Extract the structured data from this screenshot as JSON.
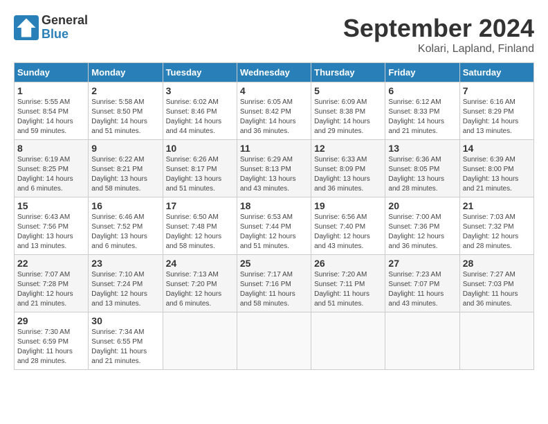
{
  "header": {
    "logo_line1": "General",
    "logo_line2": "Blue",
    "month": "September 2024",
    "location": "Kolari, Lapland, Finland"
  },
  "days_of_week": [
    "Sunday",
    "Monday",
    "Tuesday",
    "Wednesday",
    "Thursday",
    "Friday",
    "Saturday"
  ],
  "weeks": [
    [
      {
        "day": "1",
        "sunrise": "5:55 AM",
        "sunset": "8:54 PM",
        "daylight": "14 hours and 59 minutes."
      },
      {
        "day": "2",
        "sunrise": "5:58 AM",
        "sunset": "8:50 PM",
        "daylight": "14 hours and 51 minutes."
      },
      {
        "day": "3",
        "sunrise": "6:02 AM",
        "sunset": "8:46 PM",
        "daylight": "14 hours and 44 minutes."
      },
      {
        "day": "4",
        "sunrise": "6:05 AM",
        "sunset": "8:42 PM",
        "daylight": "14 hours and 36 minutes."
      },
      {
        "day": "5",
        "sunrise": "6:09 AM",
        "sunset": "8:38 PM",
        "daylight": "14 hours and 29 minutes."
      },
      {
        "day": "6",
        "sunrise": "6:12 AM",
        "sunset": "8:33 PM",
        "daylight": "14 hours and 21 minutes."
      },
      {
        "day": "7",
        "sunrise": "6:16 AM",
        "sunset": "8:29 PM",
        "daylight": "14 hours and 13 minutes."
      }
    ],
    [
      {
        "day": "8",
        "sunrise": "6:19 AM",
        "sunset": "8:25 PM",
        "daylight": "14 hours and 6 minutes."
      },
      {
        "day": "9",
        "sunrise": "6:22 AM",
        "sunset": "8:21 PM",
        "daylight": "13 hours and 58 minutes."
      },
      {
        "day": "10",
        "sunrise": "6:26 AM",
        "sunset": "8:17 PM",
        "daylight": "13 hours and 51 minutes."
      },
      {
        "day": "11",
        "sunrise": "6:29 AM",
        "sunset": "8:13 PM",
        "daylight": "13 hours and 43 minutes."
      },
      {
        "day": "12",
        "sunrise": "6:33 AM",
        "sunset": "8:09 PM",
        "daylight": "13 hours and 36 minutes."
      },
      {
        "day": "13",
        "sunrise": "6:36 AM",
        "sunset": "8:05 PM",
        "daylight": "13 hours and 28 minutes."
      },
      {
        "day": "14",
        "sunrise": "6:39 AM",
        "sunset": "8:00 PM",
        "daylight": "13 hours and 21 minutes."
      }
    ],
    [
      {
        "day": "15",
        "sunrise": "6:43 AM",
        "sunset": "7:56 PM",
        "daylight": "13 hours and 13 minutes."
      },
      {
        "day": "16",
        "sunrise": "6:46 AM",
        "sunset": "7:52 PM",
        "daylight": "13 hours and 6 minutes."
      },
      {
        "day": "17",
        "sunrise": "6:50 AM",
        "sunset": "7:48 PM",
        "daylight": "12 hours and 58 minutes."
      },
      {
        "day": "18",
        "sunrise": "6:53 AM",
        "sunset": "7:44 PM",
        "daylight": "12 hours and 51 minutes."
      },
      {
        "day": "19",
        "sunrise": "6:56 AM",
        "sunset": "7:40 PM",
        "daylight": "12 hours and 43 minutes."
      },
      {
        "day": "20",
        "sunrise": "7:00 AM",
        "sunset": "7:36 PM",
        "daylight": "12 hours and 36 minutes."
      },
      {
        "day": "21",
        "sunrise": "7:03 AM",
        "sunset": "7:32 PM",
        "daylight": "12 hours and 28 minutes."
      }
    ],
    [
      {
        "day": "22",
        "sunrise": "7:07 AM",
        "sunset": "7:28 PM",
        "daylight": "12 hours and 21 minutes."
      },
      {
        "day": "23",
        "sunrise": "7:10 AM",
        "sunset": "7:24 PM",
        "daylight": "12 hours and 13 minutes."
      },
      {
        "day": "24",
        "sunrise": "7:13 AM",
        "sunset": "7:20 PM",
        "daylight": "12 hours and 6 minutes."
      },
      {
        "day": "25",
        "sunrise": "7:17 AM",
        "sunset": "7:16 PM",
        "daylight": "11 hours and 58 minutes."
      },
      {
        "day": "26",
        "sunrise": "7:20 AM",
        "sunset": "7:11 PM",
        "daylight": "11 hours and 51 minutes."
      },
      {
        "day": "27",
        "sunrise": "7:23 AM",
        "sunset": "7:07 PM",
        "daylight": "11 hours and 43 minutes."
      },
      {
        "day": "28",
        "sunrise": "7:27 AM",
        "sunset": "7:03 PM",
        "daylight": "11 hours and 36 minutes."
      }
    ],
    [
      {
        "day": "29",
        "sunrise": "7:30 AM",
        "sunset": "6:59 PM",
        "daylight": "11 hours and 28 minutes."
      },
      {
        "day": "30",
        "sunrise": "7:34 AM",
        "sunset": "6:55 PM",
        "daylight": "11 hours and 21 minutes."
      },
      null,
      null,
      null,
      null,
      null
    ]
  ]
}
